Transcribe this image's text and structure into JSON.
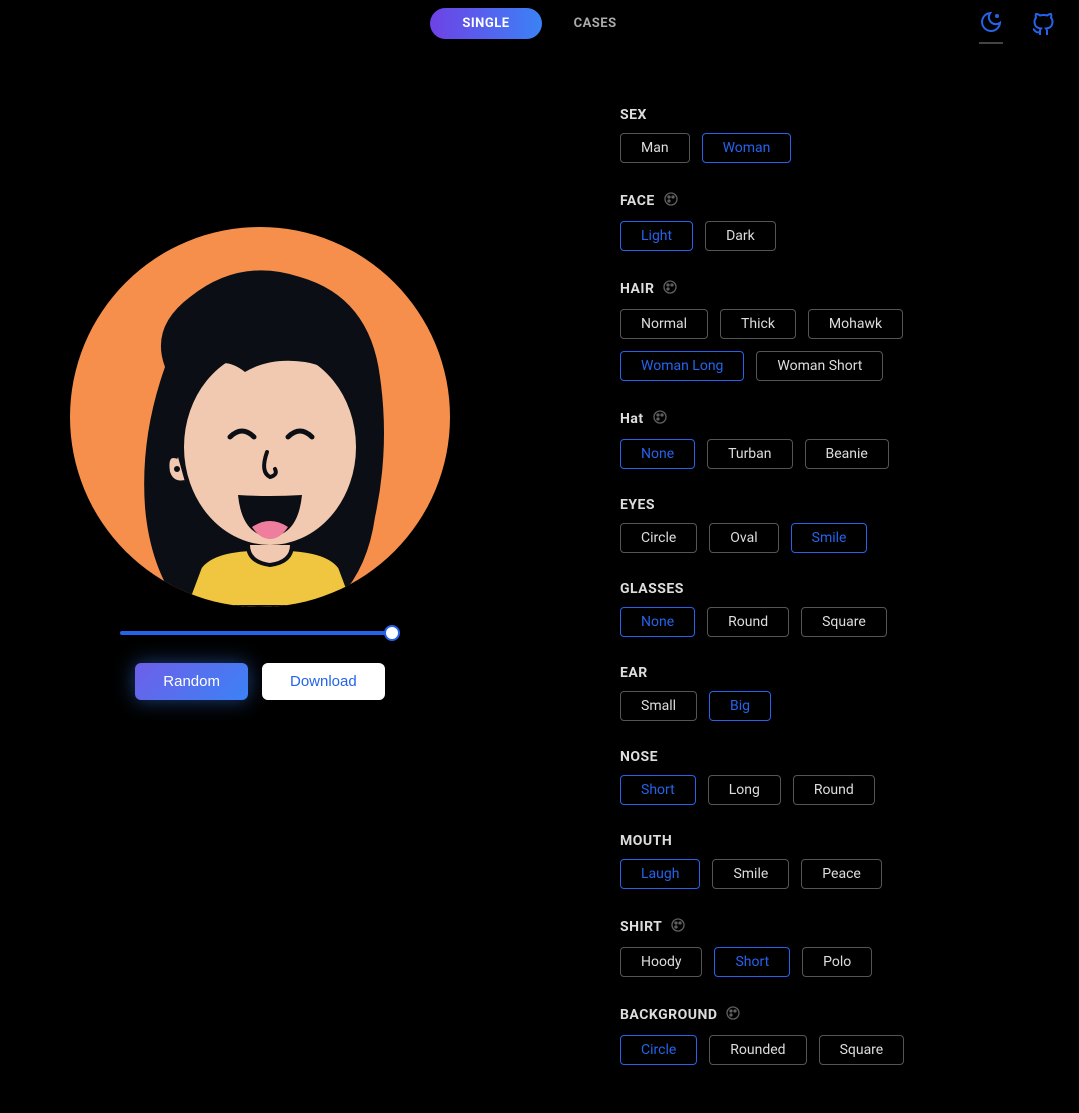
{
  "header": {
    "tabs": [
      {
        "label": "SINGLE",
        "active": true
      },
      {
        "label": "CASES",
        "active": false
      }
    ]
  },
  "actions": {
    "random_label": "Random",
    "download_label": "Download"
  },
  "slider": {
    "value": 100
  },
  "sections": [
    {
      "title": "SEX",
      "has_palette": false,
      "options": [
        {
          "label": "Man",
          "selected": false
        },
        {
          "label": "Woman",
          "selected": true
        }
      ]
    },
    {
      "title": "FACE",
      "has_palette": true,
      "options": [
        {
          "label": "Light",
          "selected": true
        },
        {
          "label": "Dark",
          "selected": false
        }
      ]
    },
    {
      "title": "HAIR",
      "has_palette": true,
      "options": [
        {
          "label": "Normal",
          "selected": false
        },
        {
          "label": "Thick",
          "selected": false
        },
        {
          "label": "Mohawk",
          "selected": false
        },
        {
          "label": "Woman Long",
          "selected": true
        },
        {
          "label": "Woman Short",
          "selected": false
        }
      ]
    },
    {
      "title": "Hat",
      "has_palette": true,
      "options": [
        {
          "label": "None",
          "selected": true
        },
        {
          "label": "Turban",
          "selected": false
        },
        {
          "label": "Beanie",
          "selected": false
        }
      ]
    },
    {
      "title": "EYES",
      "has_palette": false,
      "options": [
        {
          "label": "Circle",
          "selected": false
        },
        {
          "label": "Oval",
          "selected": false
        },
        {
          "label": "Smile",
          "selected": true
        }
      ]
    },
    {
      "title": "GLASSES",
      "has_palette": false,
      "options": [
        {
          "label": "None",
          "selected": true
        },
        {
          "label": "Round",
          "selected": false
        },
        {
          "label": "Square",
          "selected": false
        }
      ]
    },
    {
      "title": "EAR",
      "has_palette": false,
      "options": [
        {
          "label": "Small",
          "selected": false
        },
        {
          "label": "Big",
          "selected": true
        }
      ]
    },
    {
      "title": "NOSE",
      "has_palette": false,
      "options": [
        {
          "label": "Short",
          "selected": true
        },
        {
          "label": "Long",
          "selected": false
        },
        {
          "label": "Round",
          "selected": false
        }
      ]
    },
    {
      "title": "MOUTH",
      "has_palette": false,
      "options": [
        {
          "label": "Laugh",
          "selected": true
        },
        {
          "label": "Smile",
          "selected": false
        },
        {
          "label": "Peace",
          "selected": false
        }
      ]
    },
    {
      "title": "SHIRT",
      "has_palette": true,
      "options": [
        {
          "label": "Hoody",
          "selected": false
        },
        {
          "label": "Short",
          "selected": true
        },
        {
          "label": "Polo",
          "selected": false
        }
      ]
    },
    {
      "title": "BACKGROUND",
      "has_palette": true,
      "options": [
        {
          "label": "Circle",
          "selected": true
        },
        {
          "label": "Rounded",
          "selected": false
        },
        {
          "label": "Square",
          "selected": false
        }
      ]
    }
  ],
  "avatar": {
    "background_color": "#f58f4b",
    "skin_color": "#f1c9b0",
    "hair_color": "#0b0e14",
    "shirt_color": "#f0c53f",
    "tongue_color": "#ef7d9e"
  }
}
